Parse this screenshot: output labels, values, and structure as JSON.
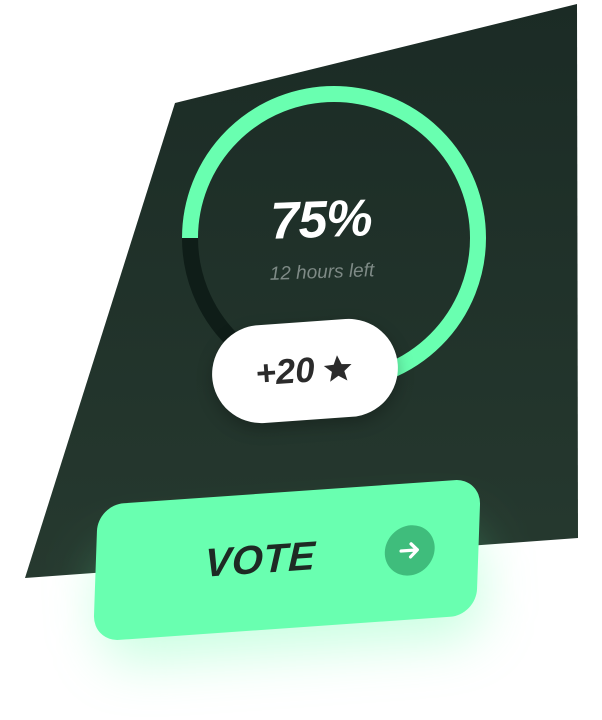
{
  "progress": {
    "percent_label": "75%",
    "fraction": 0.75,
    "time_left": "12 hours left"
  },
  "reward": {
    "label": "+20",
    "icon": "star-icon"
  },
  "vote": {
    "label": "VOTE",
    "icon": "arrow-right-icon"
  },
  "colors": {
    "panel_dark": "#1b2b25",
    "panel_light": "#24392f",
    "accent": "#69ffb0",
    "ring_track": "#0f1d18",
    "arrow_circle": "#3fbd7c"
  }
}
